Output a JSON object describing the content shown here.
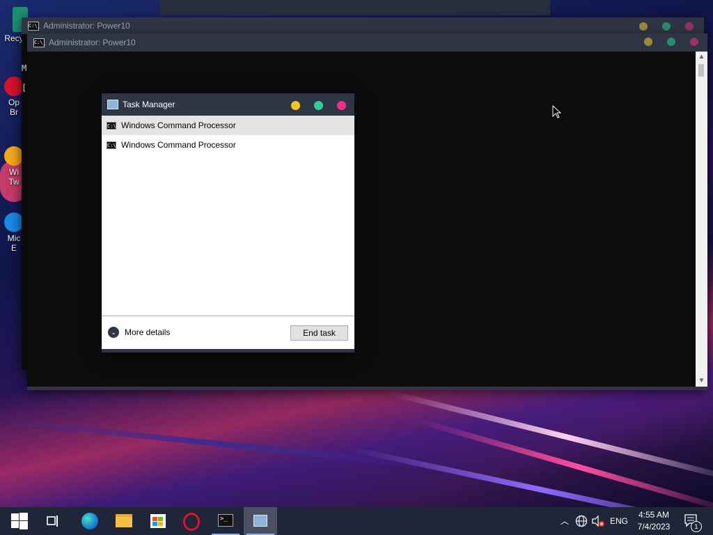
{
  "desktop": {
    "icons": [
      {
        "label": "Recy",
        "name": "recycle-bin"
      },
      {
        "label": "Op\nBr",
        "name": "opera-browser"
      },
      {
        "label": "Wi\nTw",
        "name": "windows-tweaker"
      },
      {
        "label": "Mic\nE",
        "name": "microsoft-edge"
      }
    ]
  },
  "back_window": {
    "title": "Administrator:  Power10"
  },
  "cmd_window": {
    "title": "Administrator:  Power10",
    "partial_text": [
      "M",
      "["
    ]
  },
  "task_manager": {
    "title": "Task Manager",
    "processes": [
      {
        "name": "Windows Command Processor",
        "selected": true
      },
      {
        "name": "Windows Command Processor",
        "selected": false
      }
    ],
    "more_details_label": "More details",
    "end_task_label": "End task"
  },
  "taskbar": {
    "apps": [
      "start",
      "task-view",
      "edge",
      "file-explorer",
      "store",
      "opera",
      "terminal",
      "task-manager"
    ],
    "tray": {
      "language": "ENG",
      "time": "4:55 AM",
      "date": "7/4/2023",
      "notification_count": "1"
    }
  },
  "colors": {
    "yellow": "#f5c518",
    "green": "#2ecc9a",
    "pink": "#f0308a",
    "titlebar": "#2f3545",
    "taskbar": "#1e2637"
  }
}
